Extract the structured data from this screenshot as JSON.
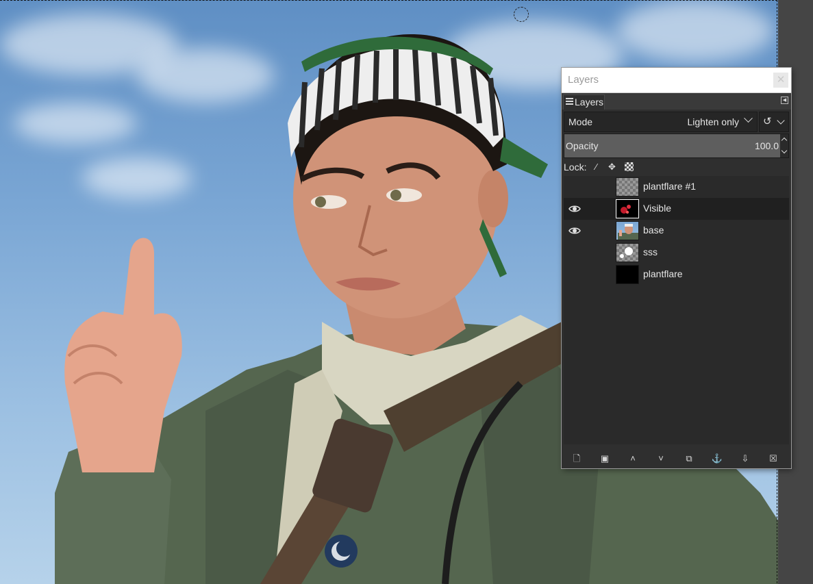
{
  "layers_dialog": {
    "title": "Layers",
    "close_icon": "close-icon",
    "tab_label": "Layers",
    "mode_label": "Mode",
    "mode_value": "Lighten only",
    "opacity_label": "Opacity",
    "opacity_value": "100.0",
    "opacity_fraction": 1.0,
    "lock_label": "Lock:",
    "lock_icons": [
      "paintbrush-icon",
      "move-icon",
      "alpha-checker-icon"
    ],
    "layers": [
      {
        "name": "plantflare #1",
        "visible": false,
        "selected": false,
        "thumb": "checker"
      },
      {
        "name": "Visible",
        "visible": true,
        "selected": true,
        "thumb": "red-sparks"
      },
      {
        "name": "base",
        "visible": true,
        "selected": false,
        "thumb": "portrait"
      },
      {
        "name": "sss",
        "visible": false,
        "selected": false,
        "thumb": "white-blobs"
      },
      {
        "name": "plantflare",
        "visible": false,
        "selected": false,
        "thumb": "black"
      }
    ],
    "bottom_buttons": [
      "new-layer-icon",
      "new-group-icon",
      "raise-layer-icon",
      "lower-layer-icon",
      "duplicate-layer-icon",
      "anchor-layer-icon",
      "merge-down-icon",
      "delete-layer-icon"
    ]
  },
  "colors": {
    "dialog_bg": "#2f2f2f",
    "selected_row": "#202020",
    "text": "#e6e6e6",
    "sky": "#7aa6d4"
  }
}
